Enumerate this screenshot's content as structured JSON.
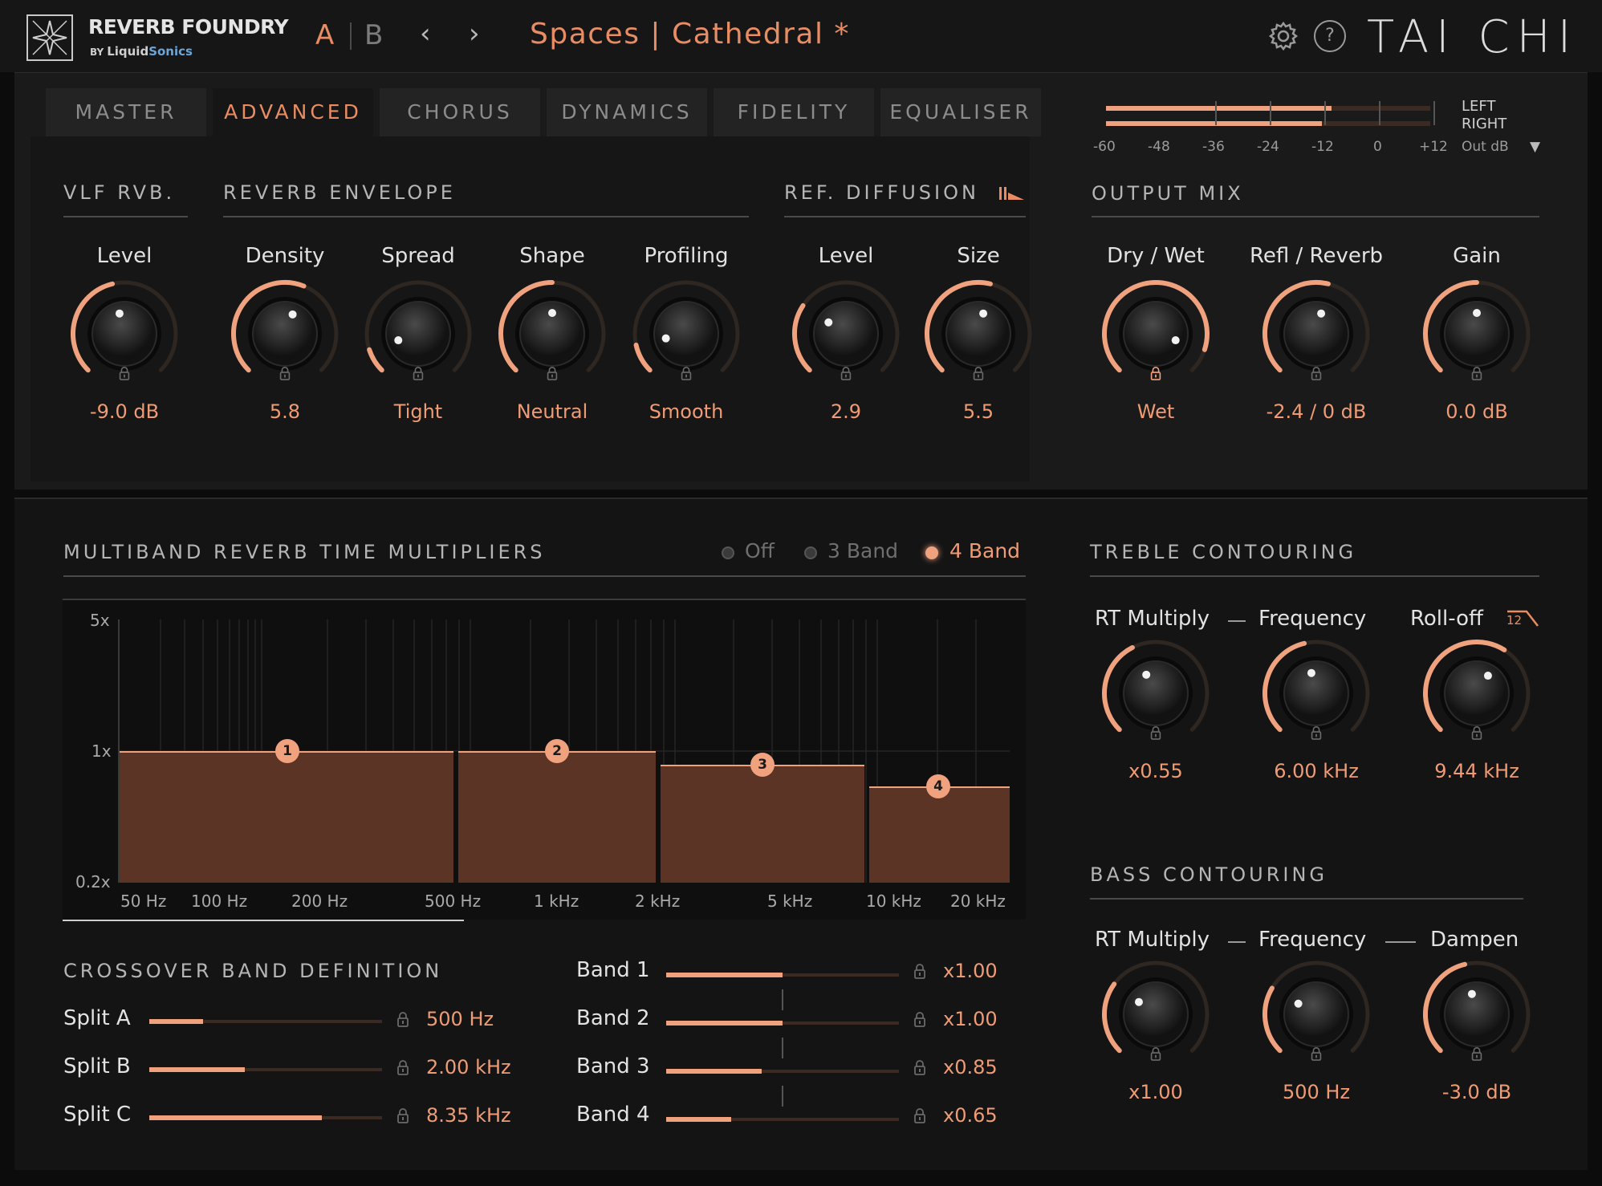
{
  "header": {
    "brand": "REVERB FOUNDRY",
    "by": "BY",
    "company_a": "Liquid",
    "company_b": "Sonics",
    "ab_a": "A",
    "ab_b": "B",
    "prev": "‹",
    "next": "›",
    "preset": "Spaces | Cathedral *",
    "help": "?",
    "product": "TAI CHI"
  },
  "tabs": [
    "MASTER",
    "ADVANCED",
    "CHORUS",
    "DYNAMICS",
    "FIDELITY",
    "EQUALISER"
  ],
  "active_tab": "ADVANCED",
  "meter": {
    "left_label": "LEFT",
    "right_label": "RIGHT",
    "scale": [
      "-60",
      "-48",
      "-36",
      "-24",
      "-12",
      "0",
      "+12"
    ],
    "mode": "Out dB",
    "dropdown": "▼",
    "left_level_db": -10,
    "right_level_db": -12
  },
  "sections": {
    "vlf": "VLF RVB.",
    "envelope": "REVERB ENVELOPE",
    "ref_diffusion": "REF. DIFFUSION",
    "output_mix": "OUTPUT MIX",
    "multiband": "MULTIBAND REVERB TIME MULTIPLIERS",
    "treble": "TREBLE CONTOURING",
    "bass": "BASS CONTOURING",
    "crossover": "CROSSOVER BAND DEFINITION"
  },
  "knobs_top": [
    {
      "name": "Level",
      "value": "-9.0 dB",
      "level": 0.45,
      "locked": false
    },
    {
      "name": "Density",
      "value": "5.8",
      "level": 0.58,
      "locked": false
    },
    {
      "name": "Spread",
      "value": "Tight",
      "level": 0.1,
      "locked": false
    },
    {
      "name": "Shape",
      "value": "Neutral",
      "level": 0.5,
      "locked": false
    },
    {
      "name": "Profiling",
      "value": "Smooth",
      "level": 0.12,
      "locked": false
    },
    {
      "name": "Level",
      "value": "2.9",
      "level": 0.29,
      "locked": false
    },
    {
      "name": "Size",
      "value": "5.5",
      "level": 0.55,
      "locked": false
    },
    {
      "name": "Dry / Wet",
      "value": "Wet",
      "level": 0.9,
      "locked": true
    },
    {
      "name": "Refl / Reverb",
      "value": "-2.4 / 0 dB",
      "level": 0.55,
      "locked": false
    },
    {
      "name": "Gain",
      "value": "0.0 dB",
      "level": 0.5,
      "locked": false
    }
  ],
  "multiband": {
    "modes": [
      "Off",
      "3 Band",
      "4 Band"
    ],
    "selected_mode": "4 Band",
    "y_labels": [
      "5x",
      "1x",
      "0.2x"
    ],
    "x_labels": [
      "50 Hz",
      "100 Hz",
      "200 Hz",
      "500 Hz",
      "1 kHz",
      "2 kHz",
      "5 kHz",
      "10 kHz",
      "20 kHz"
    ],
    "bands": [
      {
        "id": "1",
        "multiplier": 1.0
      },
      {
        "id": "2",
        "multiplier": 1.0
      },
      {
        "id": "3",
        "multiplier": 0.85
      },
      {
        "id": "4",
        "multiplier": 0.65
      }
    ]
  },
  "treble": {
    "labels": [
      "RT Multiply",
      "Frequency",
      "Roll-off"
    ],
    "rolloff_badge": "12",
    "knobs": [
      {
        "value": "x0.55",
        "level": 0.4
      },
      {
        "value": "6.00 kHz",
        "level": 0.45
      },
      {
        "value": "9.44 kHz",
        "level": 0.62
      }
    ]
  },
  "bass": {
    "labels": [
      "RT Multiply",
      "Frequency",
      "Dampen"
    ],
    "knobs": [
      {
        "value": "x1.00",
        "level": 0.3
      },
      {
        "value": "500 Hz",
        "level": 0.28
      },
      {
        "value": "-3.0 dB",
        "level": 0.45
      }
    ]
  },
  "crossover": [
    {
      "label": "Split A",
      "value": "500 Hz",
      "fill": 0.23
    },
    {
      "label": "Split B",
      "value": "2.00 kHz",
      "fill": 0.41
    },
    {
      "label": "Split C",
      "value": "8.35 kHz",
      "fill": 0.74
    }
  ],
  "band_sliders": [
    {
      "label": "Band 1",
      "value": "x1.00",
      "fill": 0.5
    },
    {
      "label": "Band 2",
      "value": "x1.00",
      "fill": 0.5
    },
    {
      "label": "Band 3",
      "value": "x0.85",
      "fill": 0.41
    },
    {
      "label": "Band 4",
      "value": "x0.65",
      "fill": 0.28
    }
  ],
  "colors": {
    "accent": "#f0a27e",
    "accent_text": "#ef9c74",
    "track": "#3a2a22",
    "background": "#141415"
  }
}
